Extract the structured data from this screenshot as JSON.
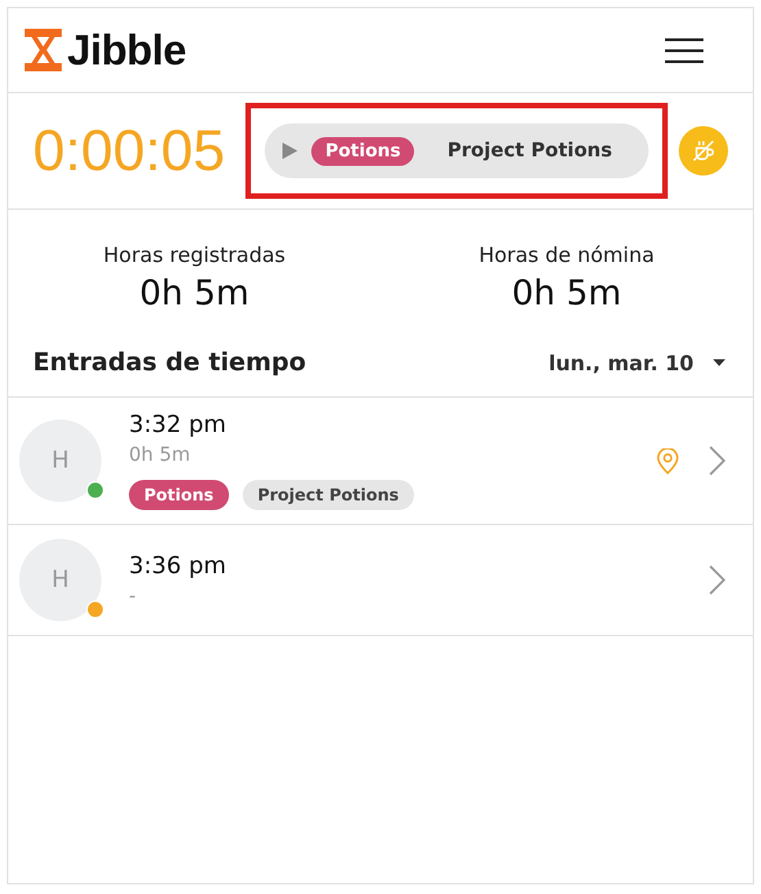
{
  "header": {
    "logo": "Jibble"
  },
  "timer": {
    "time": "0:00:05",
    "activity": "Potions",
    "project": "Project Potions"
  },
  "stats": [
    {
      "label": "Horas registradas",
      "value": "0h 5m"
    },
    {
      "label": "Horas de nómina",
      "value": "0h 5m"
    }
  ],
  "entries_title": "Entradas de tiempo",
  "date": "lun., mar. 10",
  "entries": [
    {
      "avatar": "H",
      "color": "#4caf50",
      "time": "3:32 pm",
      "duration": "0h 5m",
      "has_location": true,
      "tags": [
        {
          "kind": "activity",
          "label": "Potions"
        },
        {
          "kind": "project",
          "label": "Project Potions"
        }
      ]
    },
    {
      "avatar": "H",
      "color": "#f5a623",
      "time": "3:36 pm",
      "duration": "-",
      "has_location": false
    }
  ]
}
